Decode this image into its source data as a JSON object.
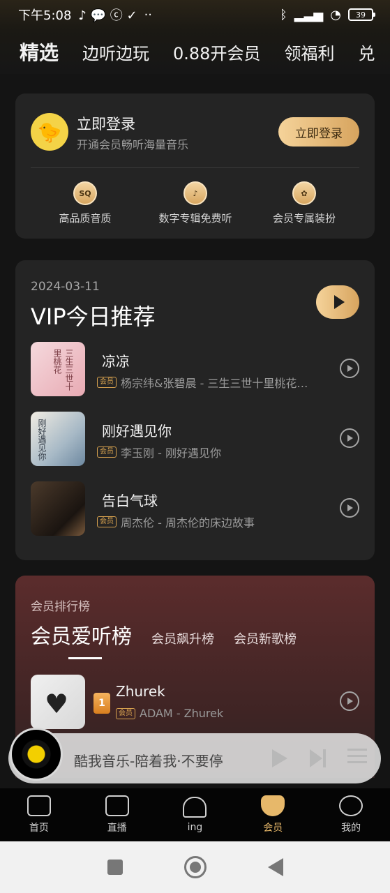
{
  "status_bar": {
    "time": "下午5:08",
    "extra": "··",
    "battery": "39"
  },
  "top_tabs": [
    "精选",
    "边听边玩",
    "0.88开会员",
    "领福利",
    "兑"
  ],
  "login": {
    "title": "立即登录",
    "subtitle": "开通会员畅听海量音乐",
    "button": "立即登录",
    "perks": [
      {
        "label": "高品质音质",
        "icon_text": "SQ"
      },
      {
        "label": "数字专辑免费听",
        "icon_text": "♪"
      },
      {
        "label": "会员专属装扮",
        "icon_text": "✿"
      }
    ]
  },
  "vip": {
    "date": "2024-03-11",
    "title": "VIP今日推荐",
    "songs": [
      {
        "title": "凉凉",
        "badge": "会员",
        "artist": "杨宗纬&张碧晨 - 三生三世十里桃花…",
        "cover_text": "三生三世十里桃花"
      },
      {
        "title": "刚好遇见你",
        "badge": "会员",
        "artist": "李玉刚 - 刚好遇见你",
        "cover_text": "刚好遇见你"
      },
      {
        "title": "告白气球",
        "badge": "会员",
        "artist": "周杰伦 - 周杰伦的床边故事",
        "cover_text": ""
      }
    ]
  },
  "ranking": {
    "kicker": "会员排行榜",
    "tabs": [
      "会员爱听榜",
      "会员飙升榜",
      "会员新歌榜"
    ],
    "song": {
      "rank": "1",
      "title": "Zhurek",
      "badge": "会员",
      "artist": "ADAM - Zhurek"
    }
  },
  "player": {
    "text": "酷我音乐-陪着我·不要停"
  },
  "bottom_nav": [
    "首页",
    "直播",
    "ing",
    "会员",
    "我的"
  ],
  "colors": {
    "accent": "#e7b86a",
    "background": "#141414",
    "card": "#242424"
  }
}
